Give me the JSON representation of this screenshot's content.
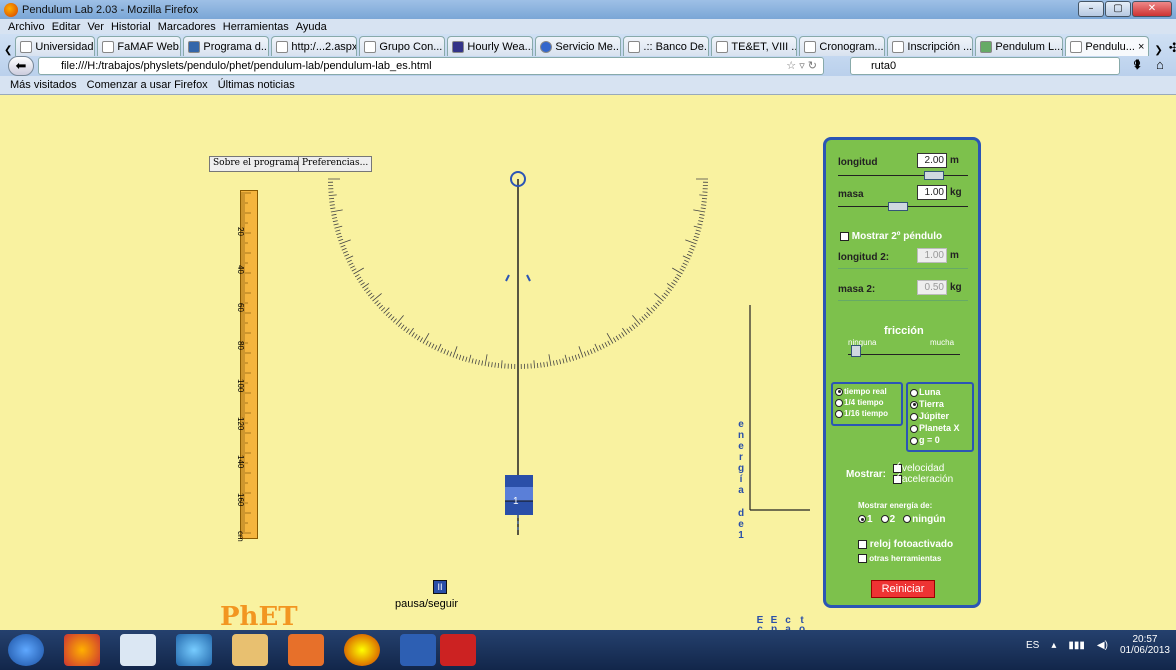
{
  "window": {
    "title": "Pendulum Lab 2.03 - Mozilla Firefox",
    "min": "–",
    "max": "▢",
    "close": "✕"
  },
  "menu": [
    "Archivo",
    "Editar",
    "Ver",
    "Historial",
    "Marcadores",
    "Herramientas",
    "Ayuda"
  ],
  "tabs": [
    "Universidad...",
    "FaMAF Web...",
    "Programa d...",
    "http:/...2.aspx",
    "Grupo Con...",
    "Hourly Wea...",
    "Servicio Me...",
    ".:: Banco De...",
    "TE&ET, VIII ...",
    "Cronogram...",
    "Inscripción ...",
    "Pendulum L...",
    "Pendulu..."
  ],
  "url": "file:///H:/trabajos/physlets/pendulo/phet/pendulum-lab/pendulum-lab_es.html",
  "search": "ruta0",
  "bookmarks": [
    "Más visitados",
    "Comenzar a usar Firefox",
    "Últimas noticias"
  ],
  "sim": {
    "about": "Sobre el programa...",
    "prefs": "Preferencias...",
    "pause": "pausa/seguir",
    "phet": "PhET",
    "bob_label": "1",
    "energy_axis": "energía de 1",
    "energy_labels": [
      "Ecin",
      "Epot",
      "calor",
      "total"
    ],
    "ruler_labels": [
      "20",
      "40",
      "60",
      "80",
      "100",
      "120",
      "140",
      "160",
      "cm"
    ]
  },
  "panel": {
    "longitud": "longitud",
    "longitud_val": "2.00",
    "unit_m": "m",
    "masa": "masa",
    "masa_val": "1.00",
    "unit_kg": "kg",
    "show2": "Mostrar 2º péndulo",
    "longitud2": "longitud 2:",
    "longitud2_val": "1.00",
    "masa2": "masa 2:",
    "masa2_val": "0.50",
    "friccion": "fricción",
    "ninguna": "ninguna",
    "mucha": "mucha",
    "time": [
      "tiempo real",
      "1/4 tiempo",
      "1/16 tiempo"
    ],
    "planets": [
      "Luna",
      "Tierra",
      "Júpiter",
      "Planeta X",
      "g = 0"
    ],
    "mostrar": "Mostrar:",
    "velocidad": "velocidad",
    "aceleracion": "aceleración",
    "energia": "Mostrar energía de:",
    "e1": "1",
    "e2": "2",
    "eninguno": "ningún",
    "reloj": "reloj fotoactivado",
    "otras": "otras herramientas",
    "reset": "Reiniciar"
  },
  "tray": {
    "lang": "ES",
    "time": "20:57",
    "date": "01/06/2013"
  }
}
